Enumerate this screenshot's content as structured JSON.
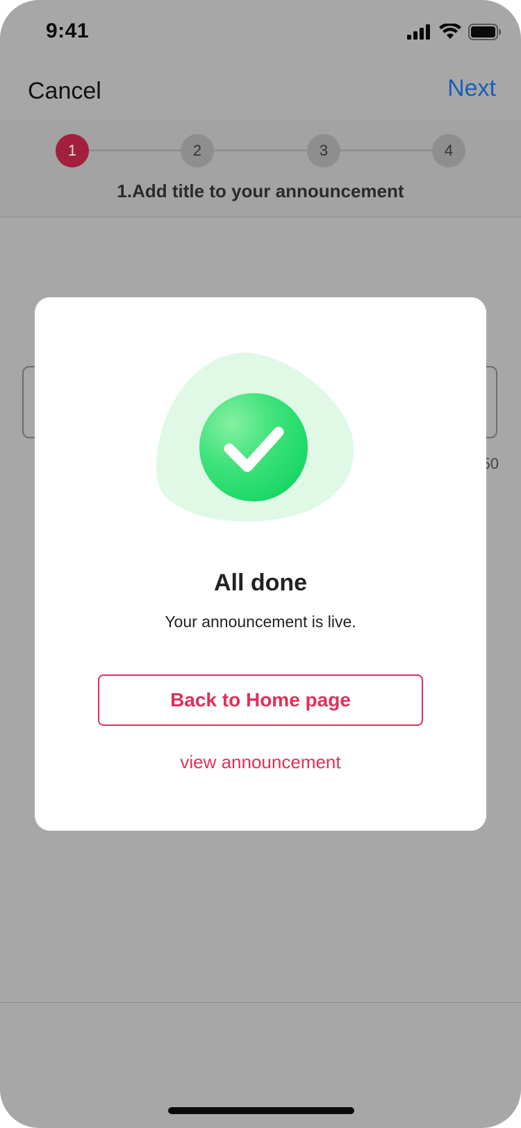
{
  "status_bar": {
    "time": "9:41",
    "icons": [
      "cellular-signal-icon",
      "wifi-icon",
      "battery-icon"
    ]
  },
  "nav": {
    "cancel_label": "Cancel",
    "next_label": "Next",
    "next_color": "#1a5fb4"
  },
  "stepper": {
    "steps": [
      "1",
      "2",
      "3",
      "4"
    ],
    "active_step": 1,
    "caption": "1.Add title to your announcement",
    "active_color": "#a3203d"
  },
  "background_form": {
    "counter_partial": "50"
  },
  "modal": {
    "icon": "success-check-icon",
    "title": "All done",
    "message": "Your announcement is live.",
    "primary_button_label": "Back to Home page",
    "secondary_link_label": "view announcement",
    "accent_color": "#e0305a",
    "success_color": "#1ed760"
  }
}
